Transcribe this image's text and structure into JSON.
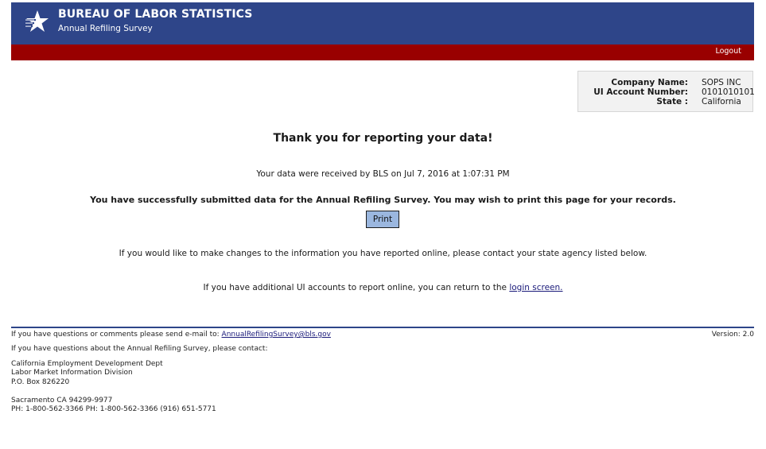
{
  "header": {
    "agency_name": "BUREAU OF LABOR STATISTICS",
    "survey_name": "Annual Refiling Survey",
    "logout_label": "Logout",
    "colors": {
      "banner": "#2e4589",
      "bar": "#990000"
    }
  },
  "account": {
    "company_label": "Company Name:",
    "company_value": "SOPS INC",
    "ui_label": "UI Account Number:",
    "ui_value": "0101010101",
    "state_label": "State :",
    "state_value": "California"
  },
  "main": {
    "thanks": "Thank you for reporting your data!",
    "received": "Your data were received by BLS on Jul 7, 2016 at  1:07:31 PM",
    "success": "You have successfully submitted data for the Annual Refiling Survey. You may wish to print this page for your records.",
    "print_label": "Print",
    "changes": "If you would like to make changes to the information you have reported online, please contact your state agency listed below.",
    "additional_prefix": "If you have additional UI accounts to report online, you can return to the ",
    "login_link": "login screen."
  },
  "footer": {
    "email_prefix": "If you have questions or comments please send e-mail to: ",
    "email_link": "AnnualRefilingSurvey@bls.gov",
    "version": "Version: 2.0",
    "contact_intro": "If you have questions about the Annual Refiling Survey, please contact:",
    "address_line1": "California Employment Development Dept",
    "address_line2": "Labor Market Information Division",
    "address_line3": "P.O. Box 826220",
    "address_city": "Sacramento  CA 94299-9977",
    "phones": "PH: 1-800-562-3366  PH: 1-800-562-3366  (916) 651-5771"
  }
}
